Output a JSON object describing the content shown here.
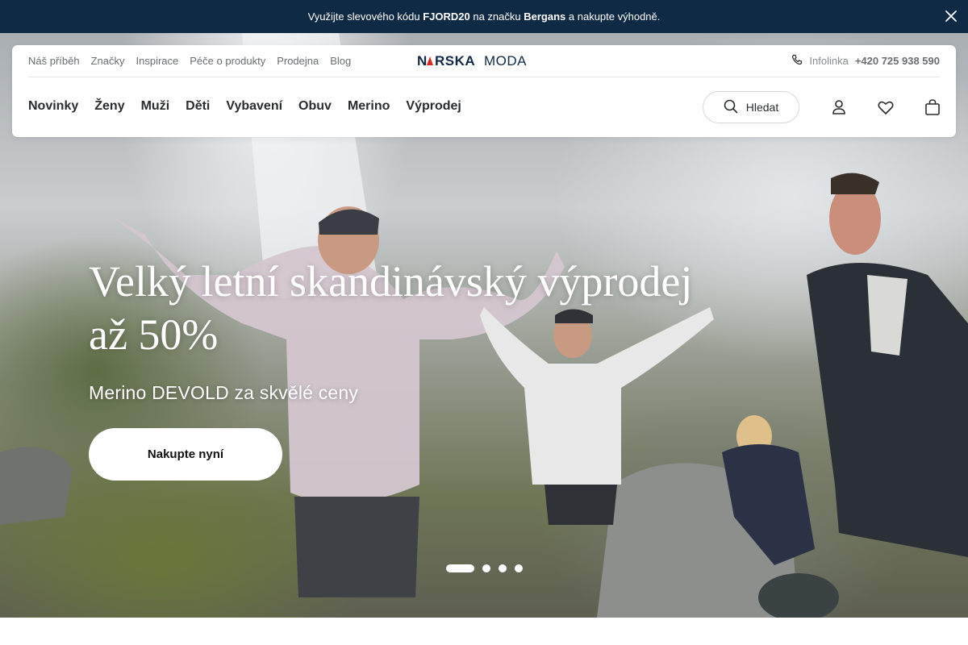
{
  "promo": {
    "pre": "Využijte slevového kódu ",
    "code": "FJORD20",
    "mid": " na značku ",
    "brand": "Bergans",
    "post": " a nakupte výhodně."
  },
  "header": {
    "top_links": [
      "Náš příběh",
      "Značky",
      "Inspirace",
      "Péče o produkty",
      "Prodejna",
      "Blog"
    ],
    "logo_text": "NORSKAMODA",
    "infoline_label": "Infolinka",
    "infoline_number": "+420 725 938 590",
    "main_nav": [
      "Novinky",
      "Ženy",
      "Muži",
      "Děti",
      "Vybavení",
      "Obuv",
      "Merino",
      "Výprodej"
    ],
    "search_label": "Hledat"
  },
  "hero": {
    "title_line1": "Velký letní skandinávský výprodej",
    "title_line2": "až 50%",
    "subtitle": "Merino DEVOLD za skvělé ceny",
    "cta_label": "Nakupte nyní",
    "slides_count": 4,
    "active_slide": 1
  },
  "icons": [
    "close-icon",
    "phone-icon",
    "search-icon",
    "user-icon",
    "heart-icon",
    "bag-icon"
  ],
  "colors": {
    "promo_bg": "#0f2a44",
    "logo_red": "#d52b1e",
    "logo_navy": "#0f2a44"
  }
}
